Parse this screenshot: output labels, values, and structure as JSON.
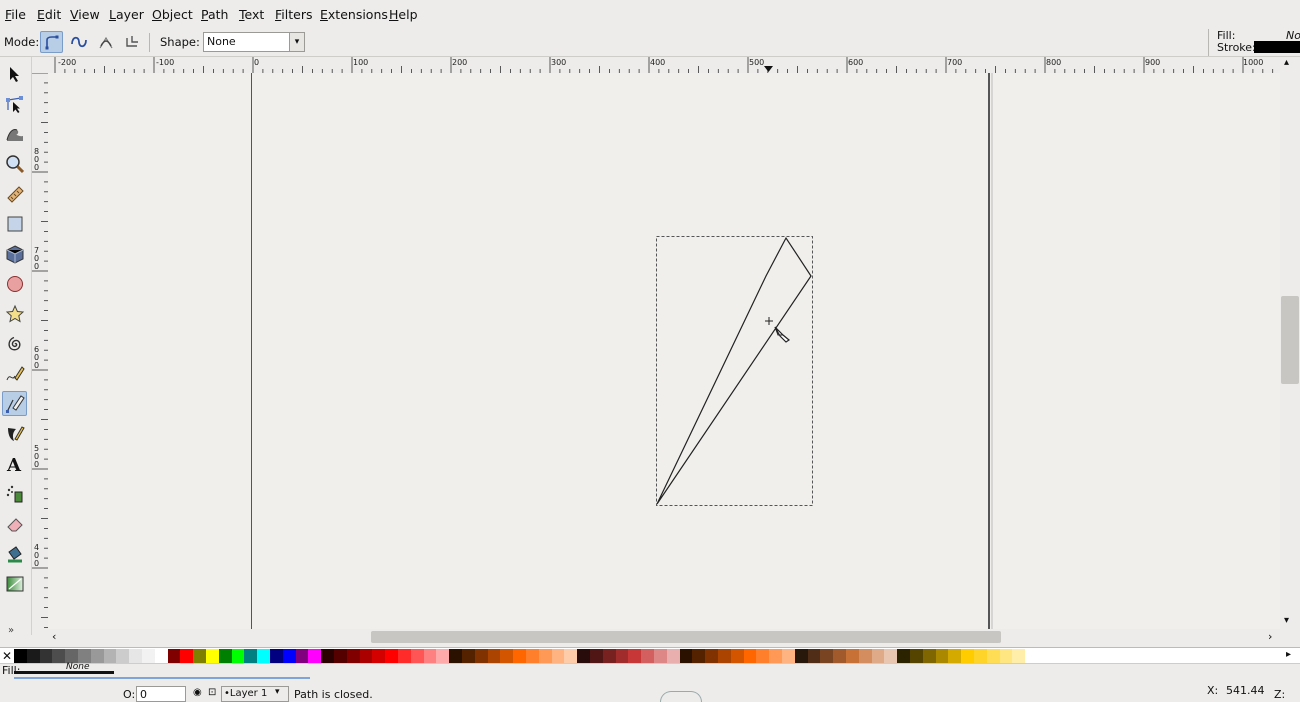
{
  "menu": [
    "File",
    "Edit",
    "View",
    "Layer",
    "Object",
    "Path",
    "Text",
    "Filters",
    "Extensions",
    "Help"
  ],
  "toolbar": {
    "mode_label": "Mode:",
    "shape_label": "Shape:",
    "shape_value": "None",
    "fill_label": "Fill:",
    "fill_value": "No",
    "stroke_label": "Stroke:",
    "modes": [
      "regular-bezier-icon",
      "spiro-path-icon",
      "bspline-path-icon",
      "paraxial-lines-icon"
    ]
  },
  "tools": [
    "selector-tool",
    "node-tool",
    "tweak-tool",
    "zoom-tool",
    "measure-tool",
    "rectangle-tool",
    "3d-box-tool",
    "ellipse-tool",
    "star-tool",
    "spiral-tool",
    "pencil-tool",
    "pen-tool",
    "calligraphy-tool",
    "text-tool",
    "spray-tool",
    "eraser-tool",
    "paint-bucket-tool",
    "gradient-tool"
  ],
  "active_tool": "pen-tool",
  "ruler_top": [
    "-200",
    "-100",
    "0",
    "100",
    "200",
    "300",
    "400",
    "500",
    "600",
    "700",
    "800",
    "900",
    "1000"
  ],
  "ruler_left": [
    "8",
    "0",
    "0",
    "7",
    "0",
    "0",
    "6",
    "0",
    "0",
    "5",
    "0",
    "0",
    "4",
    "0",
    "0"
  ],
  "status": {
    "fill_label": "Fill:",
    "fill_value": "None",
    "opacity_label": "O:",
    "opacity_value": "0",
    "layer": "•Layer 1",
    "message": "Path is closed.",
    "x_label": "X:",
    "x_value": "541.44",
    "z_label": "Z:"
  },
  "colors": {
    "accent": "#b8cde6",
    "canvas": "#f1efec",
    "chrome": "#edecea"
  }
}
